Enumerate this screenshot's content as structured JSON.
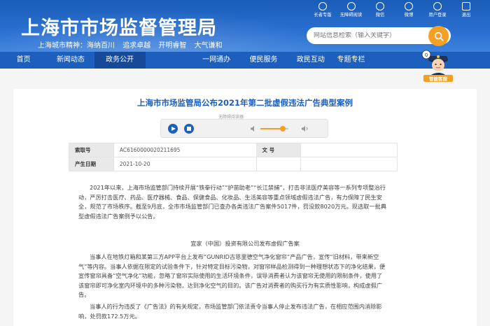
{
  "header": {
    "site_title": "上海市市场监督管理局",
    "slogan": {
      "prefix": "上海城市精神：",
      "phrases": [
        "海纳百川",
        "追求卓越",
        "开明睿智",
        "大气谦和"
      ]
    },
    "utilities": [
      {
        "label": "长者专版",
        "icon": "elder-icon"
      },
      {
        "label": "无障碍阅读",
        "icon": "accessibility-icon"
      },
      {
        "label": "微信",
        "icon": "wechat-icon"
      },
      {
        "label": "微博",
        "icon": "weibo-icon"
      },
      {
        "label": "用户登录",
        "icon": "user-icon"
      },
      {
        "label": "退出",
        "icon": "logout-icon"
      }
    ],
    "search_placeholder": "网站信息检索（输入关键字）"
  },
  "nav": {
    "items": [
      "首页",
      "新闻动态",
      "政务公开",
      "一网通办",
      "便民服务",
      "政民互动",
      "专题专栏"
    ],
    "active_index": 2
  },
  "assistant": {
    "badge": "智能客服"
  },
  "article": {
    "title": "上海市市场监管局公布2021年第二批虚假违法广告典型案例",
    "audio_label": "无障碍阅读器",
    "meta": {
      "index_key": "索取号",
      "index_value": "AC616000002021​1695",
      "doc_key": "文 号",
      "doc_value": "",
      "date_key": "产生日期",
      "date_value": "2021-10-20"
    },
    "para1": "2021年以来，上海市场监管部门持续开展“铁拳行动”“护苗助老”“长江禁捕”，打击非法医疗美容等一系列专项整治行动，严厉打击医疗、药品、医疗器械、食品、保健食品、化妆品、生活美容等重点领域虚假违法广告，有力保障了民生安全，规范了市场秩序。截至9月底，全市市场监管部门已查办各类违法广告案件5017件，罚没款8020万元。现选取一批典型虚假违法广告案例予以公告。",
    "case_title": "宜家（中国）投资有限公司发布虚假广告案",
    "para2": "当事人在地铁灯箱和某第三方APP平台上发布“GUNRID古恩里德空气净化窗帘”产品广告，宣传“旧材料，带来新空气”等内容。当事人依据在限定的试验条件下，针对特定目标污染物，对窗帘样品检测得到一种理想状态下的净化结果，便宣传窗帘具备“空气净化”功能，忽略了窗帘实际使用的生活环境条件，误导消费者认为该窗帘无使用的限制条件，使用了该窗帘即可净化室内环境中的多种污染物，达到净化空气的目的。该广告对消费者的购买行为有实质性影响，构成虚假广告。",
    "para3": "当事人的行为违反了《广告法》的有关规定，市场监管部门依法责令当事人停止发布违法广告，在相应范围内消除影响，处罚款172.5万元。"
  },
  "colors": {
    "brand_blue": "#1d5fbd",
    "accent_orange": "#f4a024"
  }
}
